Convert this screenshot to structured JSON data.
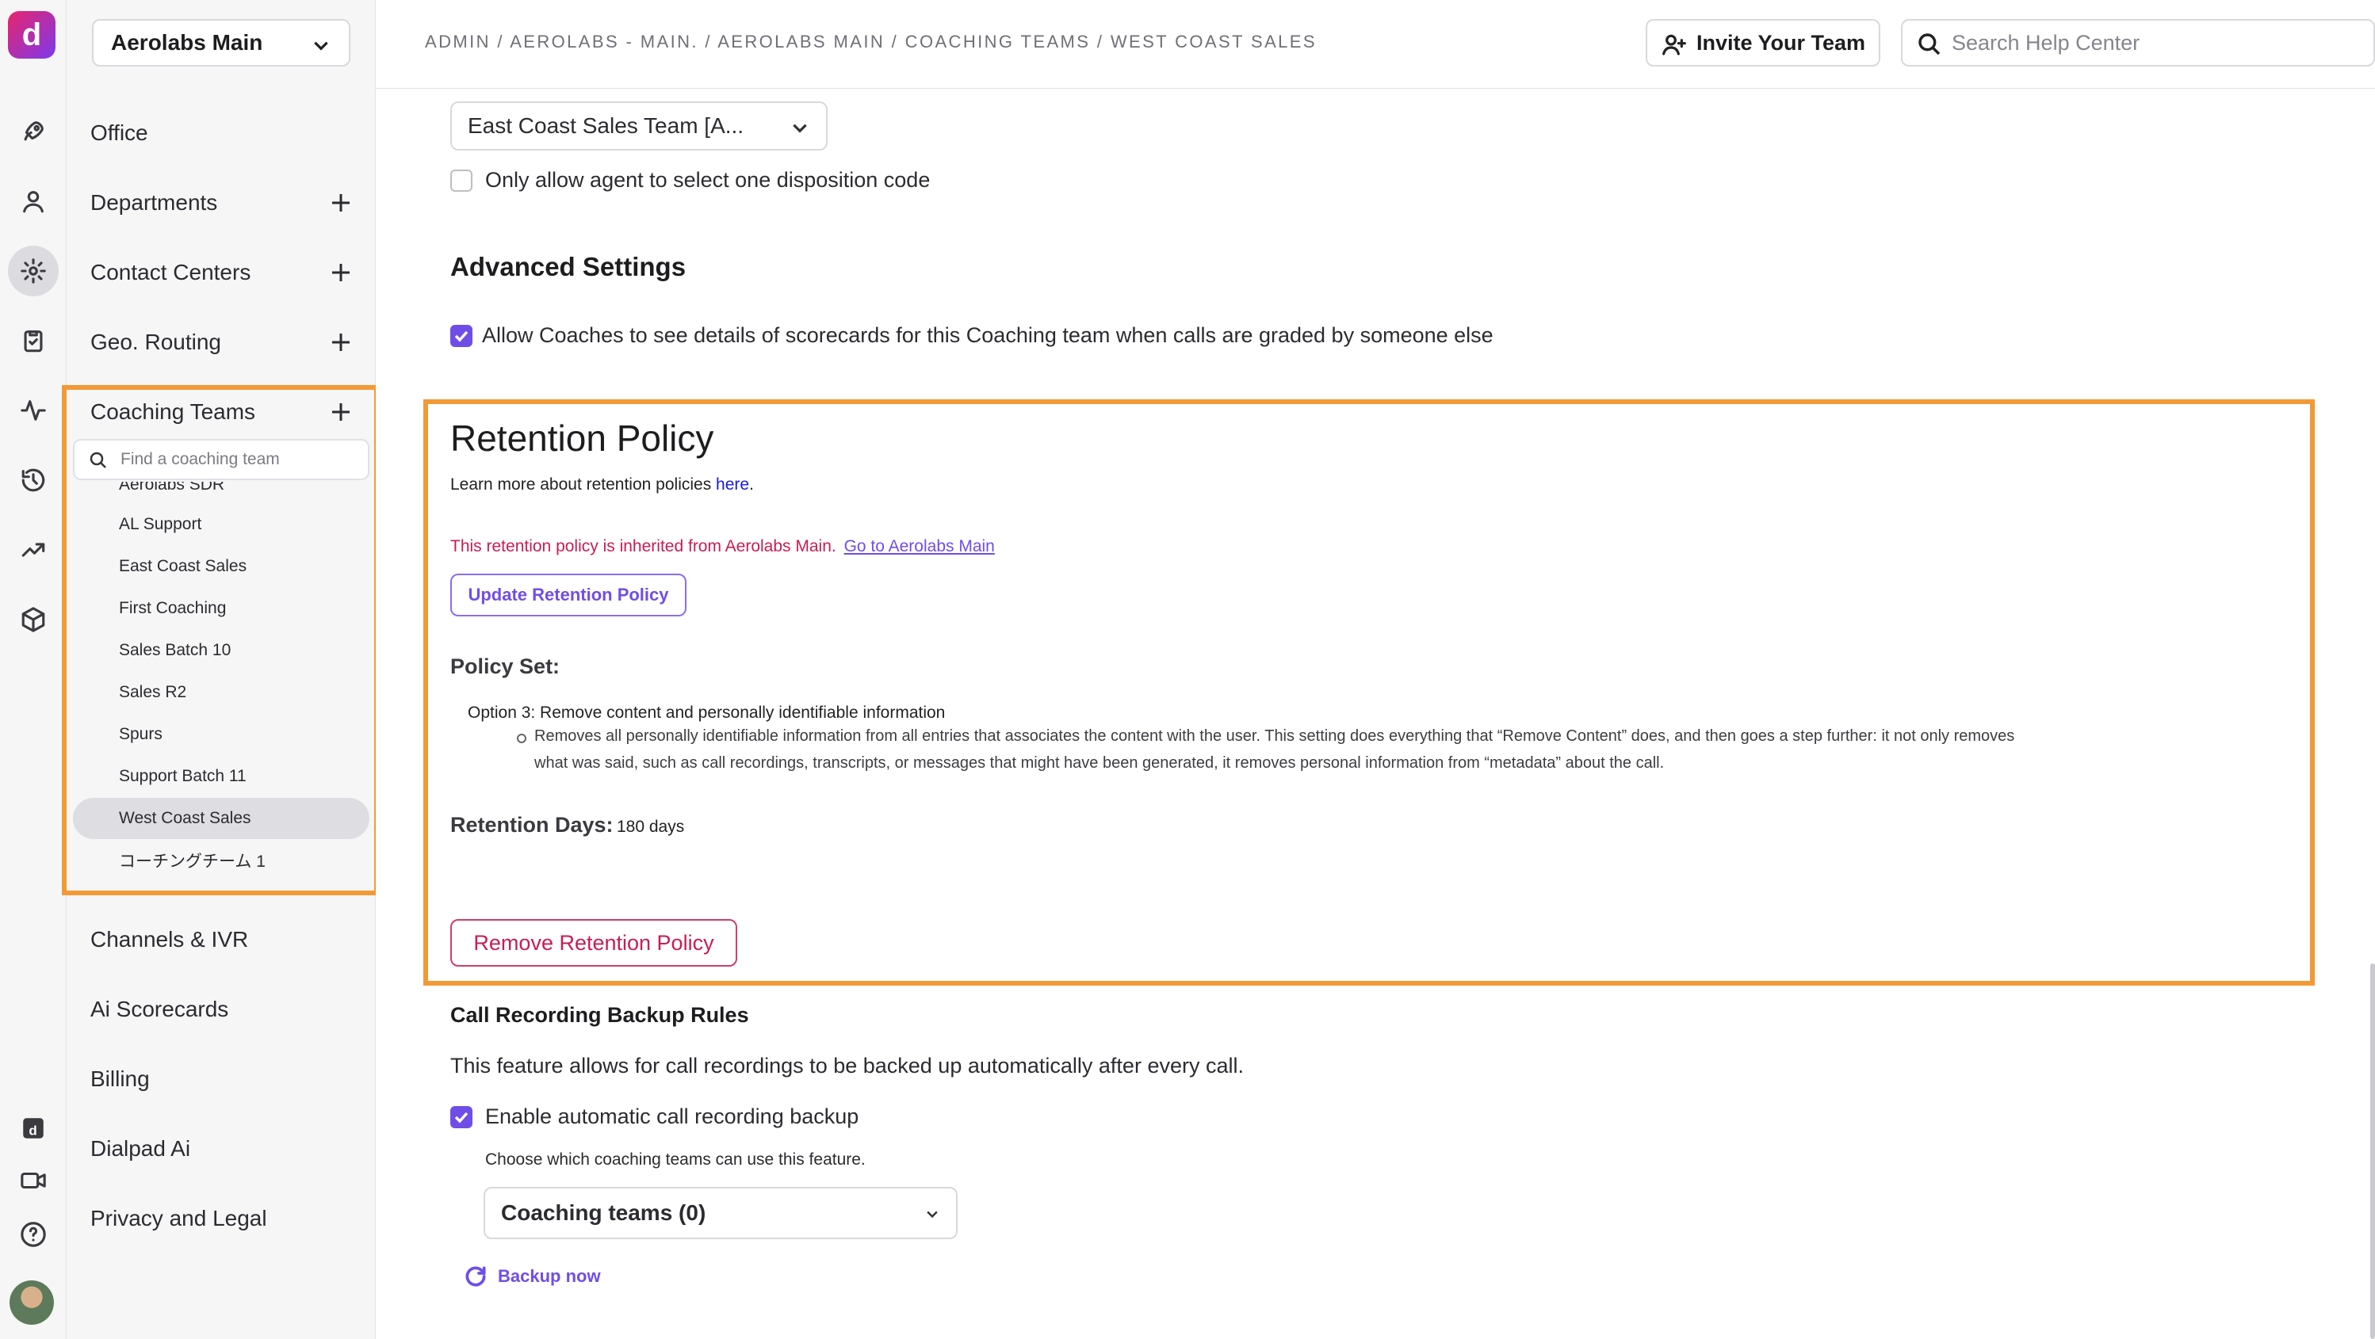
{
  "rail": {
    "logo_glyph": "d",
    "icons": [
      "rocket-icon",
      "user-icon",
      "gear-icon",
      "clipboard-icon",
      "activity-icon",
      "history-icon",
      "trend-icon",
      "cube-icon",
      "dialpad-ai-icon",
      "video-icon",
      "help-icon"
    ]
  },
  "sidebar": {
    "org_name": "Aerolabs Main",
    "items": [
      {
        "label": "Office",
        "has_add": false
      },
      {
        "label": "Departments",
        "has_add": true
      },
      {
        "label": "Contact Centers",
        "has_add": true
      },
      {
        "label": "Geo. Routing",
        "has_add": true
      },
      {
        "label": "Coaching Teams",
        "has_add": true
      },
      {
        "label": "Channels & IVR",
        "has_add": false
      },
      {
        "label": "Ai Scorecards",
        "has_add": false
      },
      {
        "label": "Billing",
        "has_add": false
      },
      {
        "label": "Dialpad Ai",
        "has_add": false
      },
      {
        "label": "Privacy and Legal",
        "has_add": false
      }
    ],
    "coaching_search_placeholder": "Find a coaching team",
    "coaching_teams": [
      "Aerolabs SDR",
      "AL Support",
      "East Coast Sales",
      "First Coaching",
      "Sales Batch 10",
      "Sales R2",
      "Spurs",
      "Support Batch 11",
      "West Coast Sales",
      "コーチングチーム 1"
    ],
    "selected_team": "West Coast Sales"
  },
  "topbar": {
    "breadcrumb": "ADMIN / AEROLABS - MAIN. / AEROLABS MAIN / COACHING TEAMS / WEST COAST SALES",
    "invite_label": "Invite Your Team",
    "search_placeholder": "Search Help Center"
  },
  "main": {
    "team_select_value": "East Coast Sales Team [A...",
    "disposition_label": "Only allow agent to select one disposition code",
    "disposition_checked": false,
    "advanced_heading": "Advanced Settings",
    "advanced_option": "Allow Coaches to see details of scorecards for this Coaching team when calls are graded by someone else",
    "advanced_checked": true,
    "retention": {
      "title": "Retention Policy",
      "learn_text": "Learn more about retention policies ",
      "learn_link": "here",
      "learn_suffix": ".",
      "inherited_text": "This retention policy is inherited from Aerolabs Main.",
      "goto_link": "Go to Aerolabs Main",
      "update_button": "Update Retention Policy",
      "policy_set_label": "Policy Set:",
      "option_title": "Option 3: Remove content and personally identifiable information",
      "option_desc_line1": "Removes all personally identifiable information from all entries that associates the content with the user. This setting does everything that “Remove Content” does, and then goes a step further: it not only removes",
      "option_desc_line2": "what was said, such as call recordings, transcripts, or messages that might have been generated, it removes personal information from “metadata” about the call.",
      "days_label": "Retention Days:",
      "days_value": "180 days",
      "remove_button": "Remove Retention Policy"
    },
    "backup": {
      "heading": "Call Recording Backup Rules",
      "desc": "This feature allows for call recordings to be backed up automatically after every call.",
      "enable_label": "Enable automatic call recording backup",
      "enable_checked": true,
      "choose_label": "Choose which coaching teams can use this feature.",
      "coaching_select_value": "Coaching teams (0)",
      "backup_now": "Backup now"
    }
  },
  "colors": {
    "accent": "#6f4ee8",
    "highlight": "#f29a35",
    "danger": "#c81d53"
  }
}
